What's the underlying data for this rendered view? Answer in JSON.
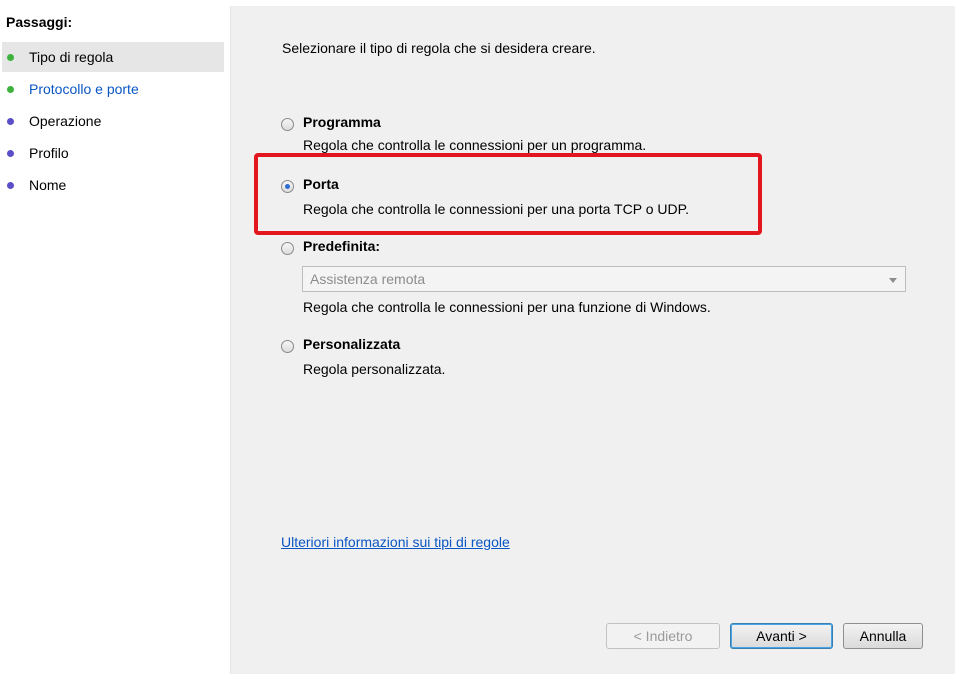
{
  "sidebar": {
    "title": "Passaggi:",
    "steps": [
      {
        "label": "Tipo di regola",
        "bullet_color": "#3db33d"
      },
      {
        "label": "Protocollo e porte",
        "bullet_color": "#3db33d"
      },
      {
        "label": "Operazione",
        "bullet_color": "#5a4fc9"
      },
      {
        "label": "Profilo",
        "bullet_color": "#5a4fc9"
      },
      {
        "label": "Nome",
        "bullet_color": "#5a4fc9"
      }
    ]
  },
  "main": {
    "intro": "Selezionare il tipo di regola che si desidera creare.",
    "options": [
      {
        "title": "Programma",
        "desc": "Regola che controlla le connessioni per un programma.",
        "checked": false
      },
      {
        "title": "Porta",
        "desc": "Regola che controlla le connessioni per una porta TCP o UDP.",
        "checked": true
      },
      {
        "title": "Predefinita:",
        "desc": "Regola che controlla le connessioni per una funzione di Windows.",
        "checked": false
      },
      {
        "title": "Personalizzata",
        "desc": "Regola personalizzata.",
        "checked": false
      }
    ],
    "predefined_select_value": "Assistenza remota",
    "more_info_link": "Ulteriori informazioni sui tipi di regole"
  },
  "buttons": {
    "back": "< Indietro",
    "next": "Avanti >",
    "cancel": "Annulla"
  },
  "colors": {
    "highlight": "#e3151e",
    "link": "#0a56c4"
  }
}
